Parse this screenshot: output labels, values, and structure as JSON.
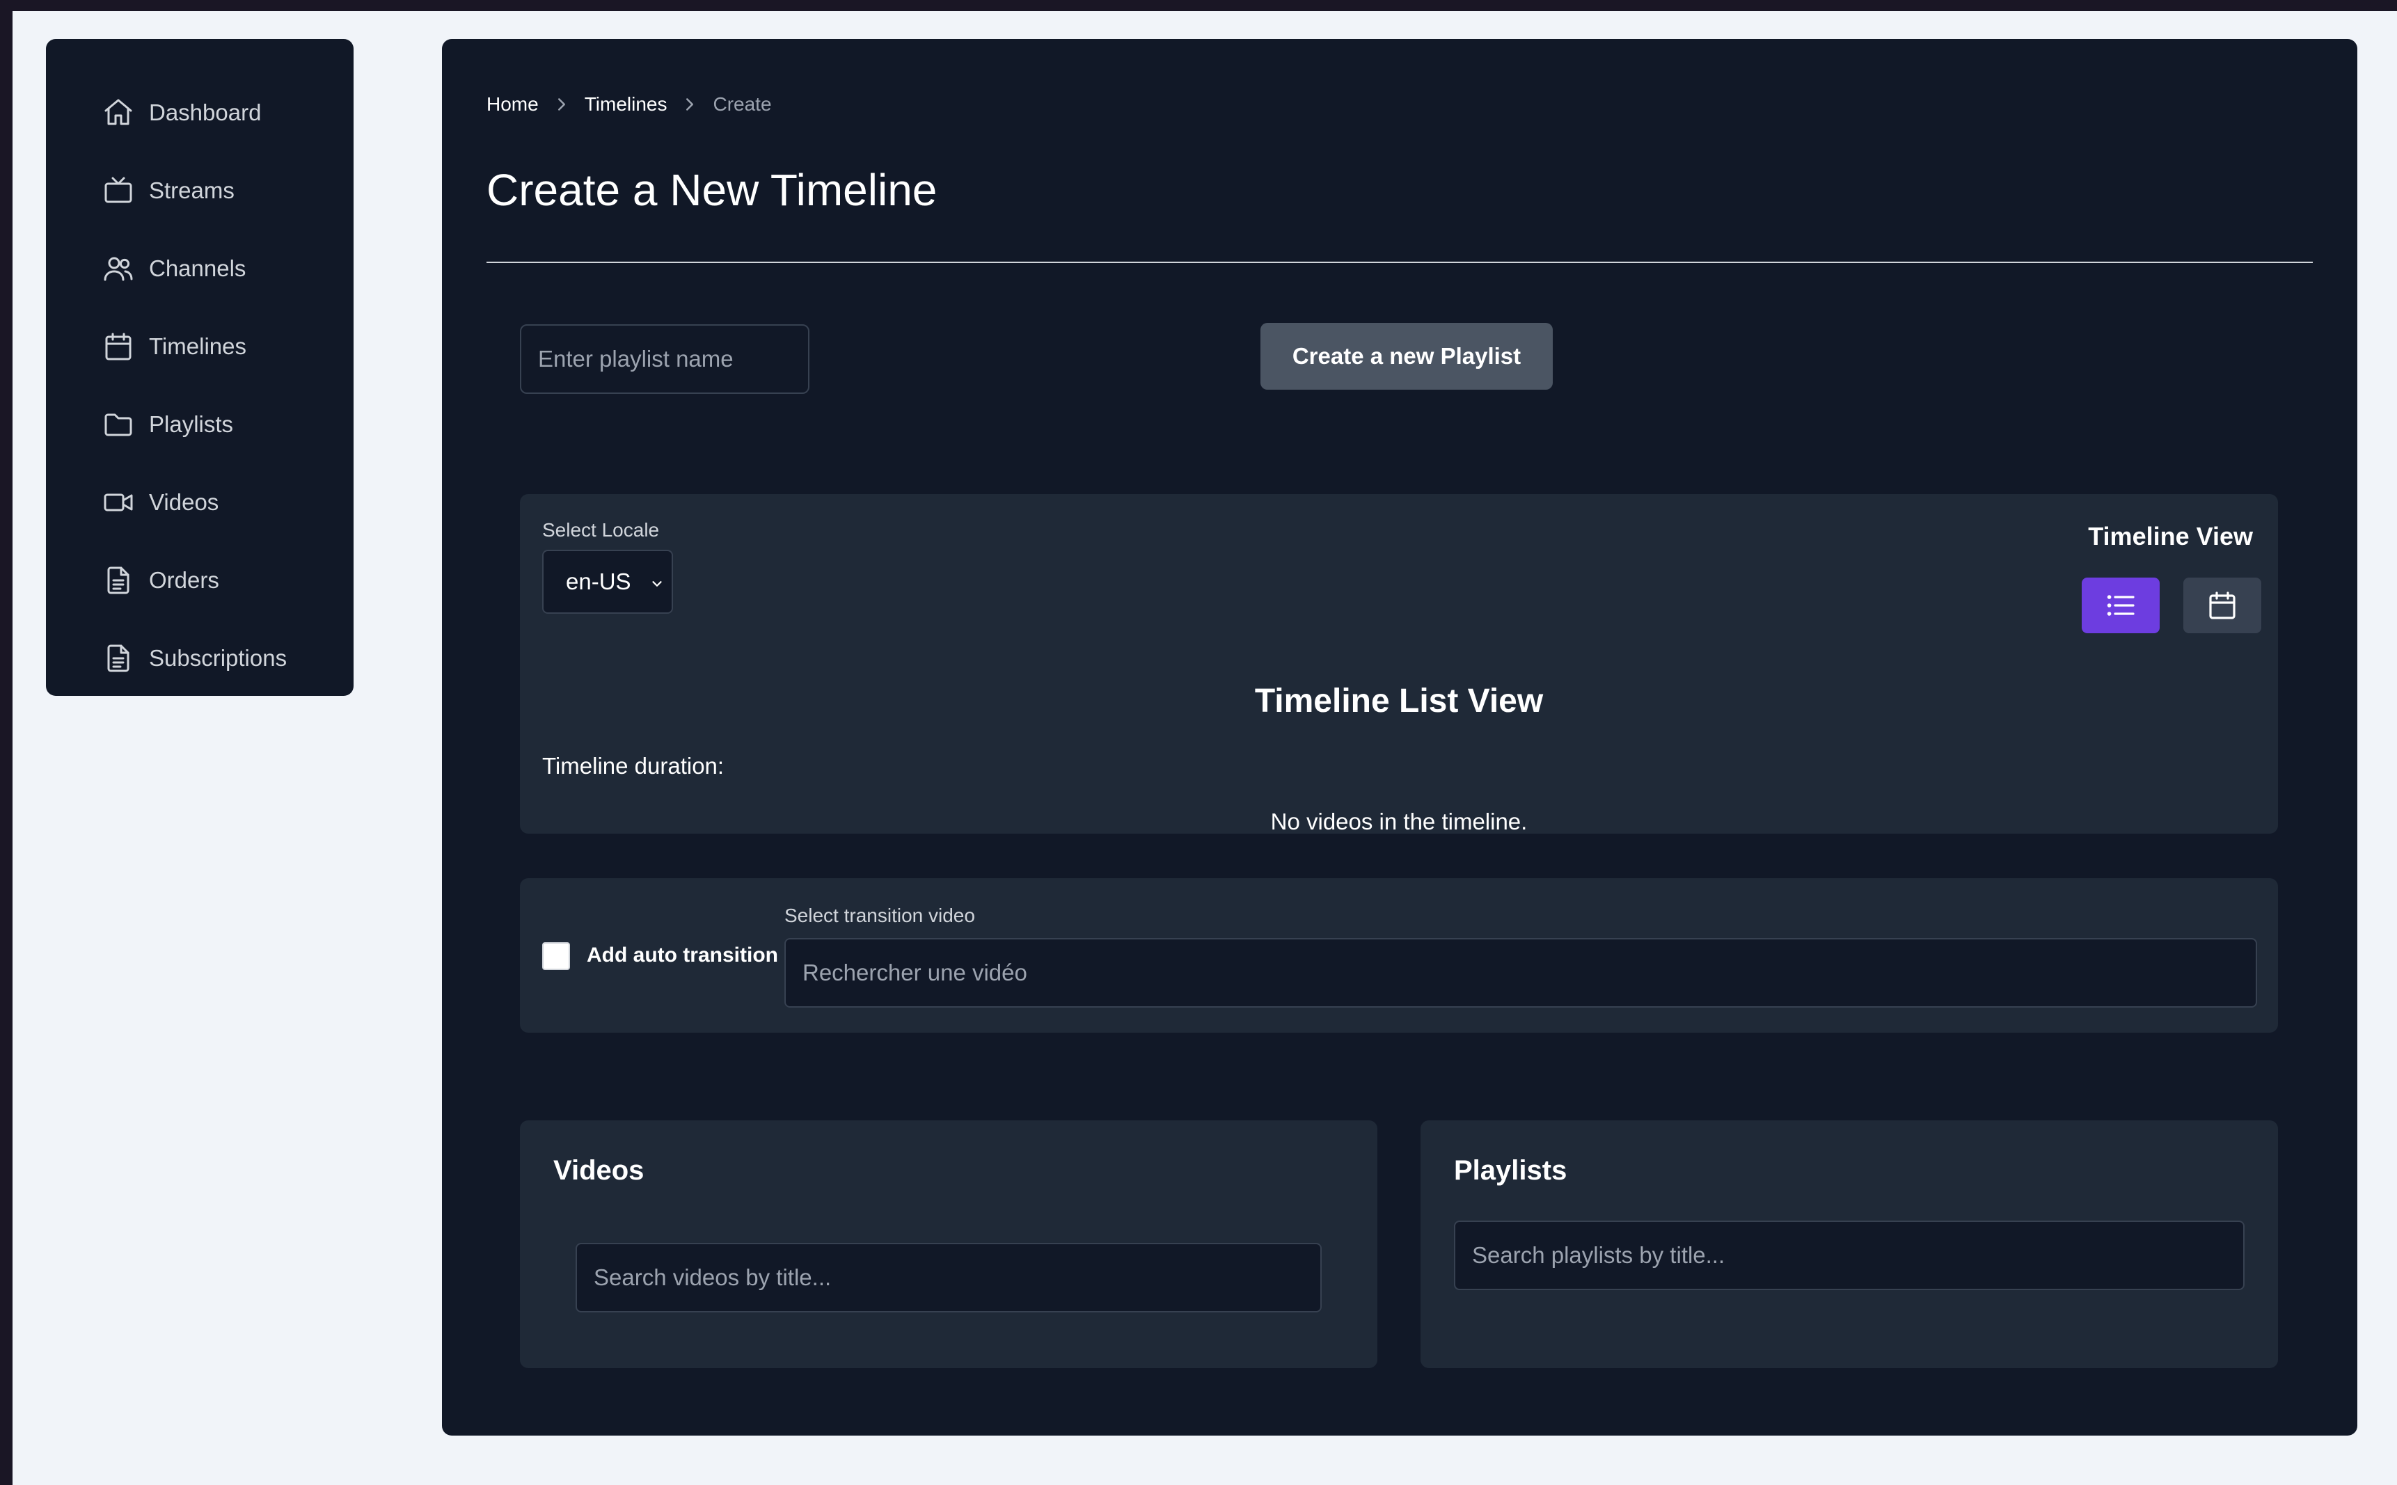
{
  "sidebar": {
    "items": [
      {
        "label": "Dashboard",
        "icon": "home-icon"
      },
      {
        "label": "Streams",
        "icon": "tv-icon"
      },
      {
        "label": "Channels",
        "icon": "users-icon"
      },
      {
        "label": "Timelines",
        "icon": "calendar-icon"
      },
      {
        "label": "Playlists",
        "icon": "folder-icon"
      },
      {
        "label": "Videos",
        "icon": "video-camera-icon"
      },
      {
        "label": "Orders",
        "icon": "document-icon"
      },
      {
        "label": "Subscriptions",
        "icon": "document-icon"
      }
    ]
  },
  "breadcrumb": {
    "home": "Home",
    "timelines": "Timelines",
    "current": "Create"
  },
  "page": {
    "title": "Create a New Timeline"
  },
  "playlist_form": {
    "placeholder": "Enter playlist name",
    "button_label": "Create a new Playlist"
  },
  "timeline": {
    "locale_label": "Select Locale",
    "locale_value": "en-US",
    "view_label": "Timeline View",
    "list_view_title": "Timeline List View",
    "duration_label": "Timeline duration:",
    "empty_message": "No videos in the timeline.",
    "active_view": "list"
  },
  "transition": {
    "checkbox_label": "Add auto transition",
    "checked": false,
    "select_label": "Select transition video",
    "placeholder": "Rechercher une vidéo"
  },
  "videos_card": {
    "title": "Videos",
    "search_placeholder": "Search videos by title..."
  },
  "playlists_card": {
    "title": "Playlists",
    "search_placeholder": "Search playlists by title..."
  },
  "colors": {
    "panel_bg": "#111827",
    "card_bg": "#1f2937",
    "accent": "#6d3de0",
    "page_bg": "#f1f4f9"
  }
}
